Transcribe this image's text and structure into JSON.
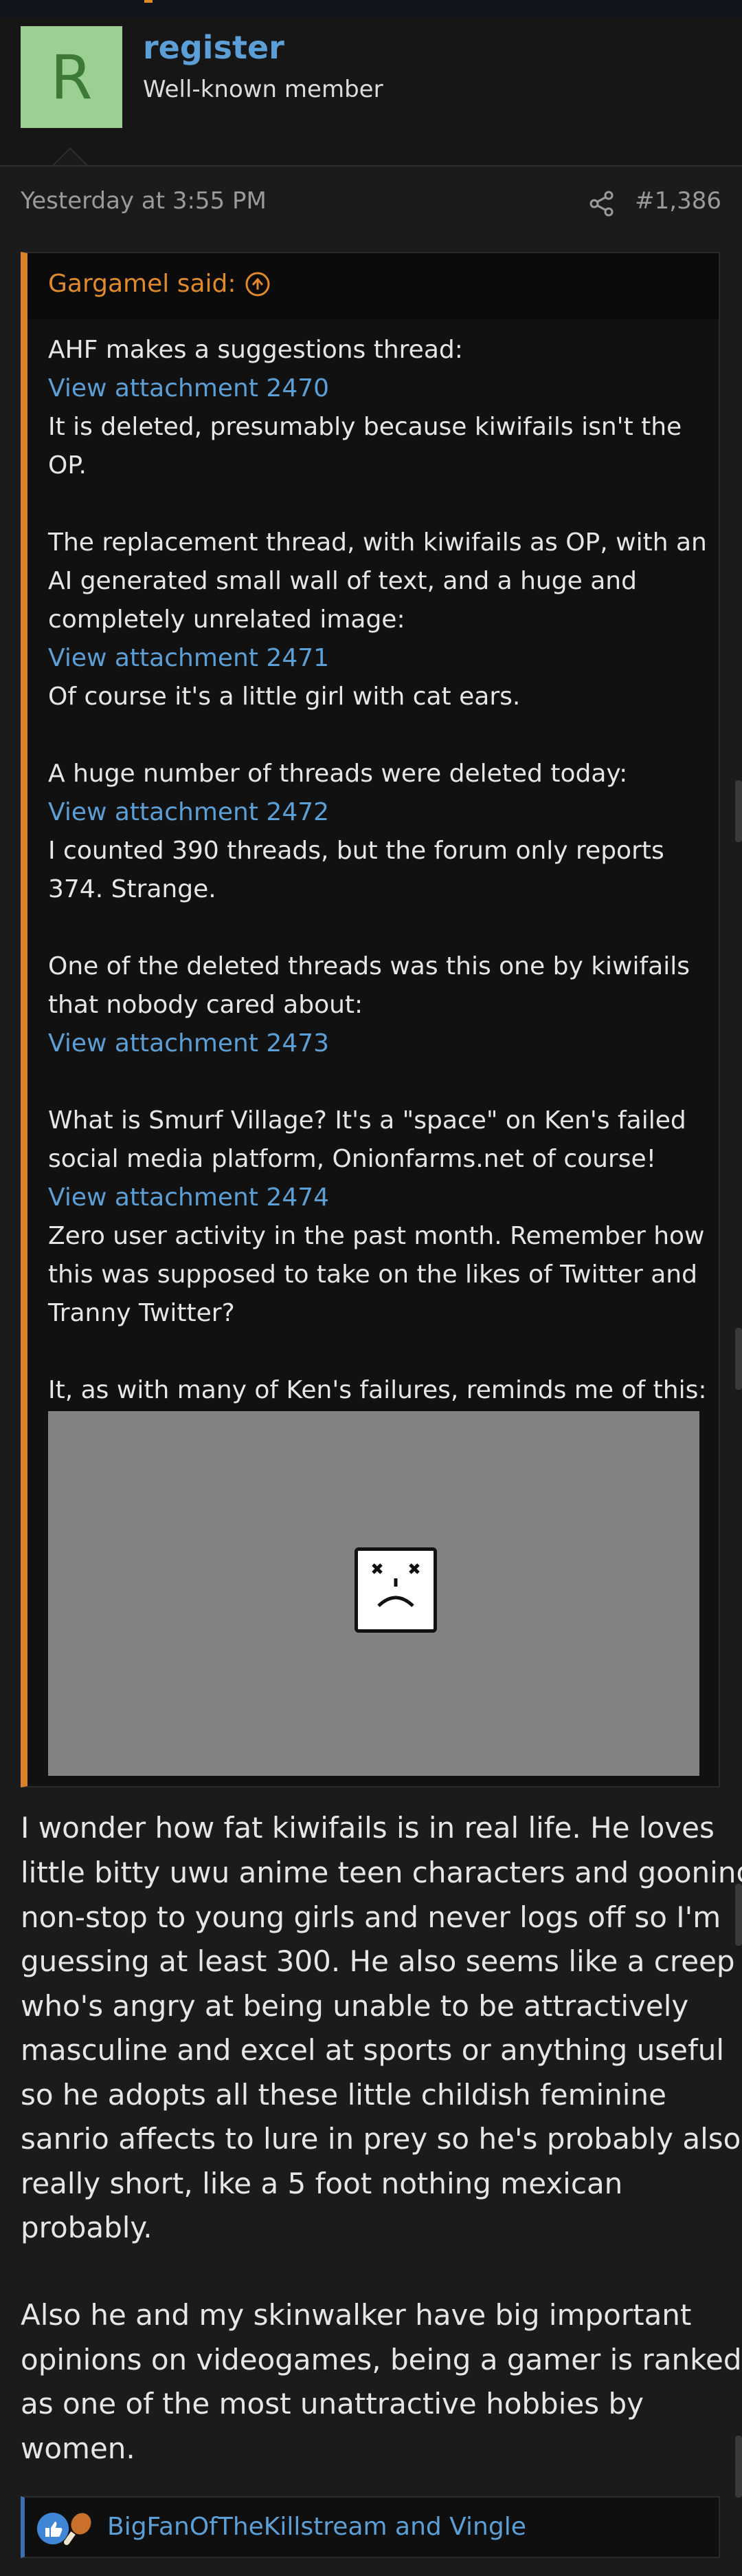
{
  "user": {
    "avatar_letter": "R",
    "name": "register",
    "title": "Well-known member"
  },
  "post": {
    "time": "Yesterday at 3:55 PM",
    "number": "#1,386"
  },
  "quote": {
    "author": "Gargamel said:",
    "lines": [
      {
        "text": "AHF makes a suggestions thread:",
        "link": false
      },
      {
        "text": "View attachment 2470",
        "link": true
      },
      {
        "text": "It is deleted, presumably because kiwifails isn't the",
        "link": false
      },
      {
        "text": "OP.",
        "link": false
      },
      {
        "text": "The replacement thread, with kiwifails as OP, with an",
        "link": false
      },
      {
        "text": "AI generated small wall of text, and a huge and",
        "link": false
      },
      {
        "text": "completely unrelated image:",
        "link": false
      },
      {
        "text": "View attachment 2471",
        "link": true
      },
      {
        "text": "Of course it's a little girl with cat ears.",
        "link": false
      },
      {
        "text": "A huge number of threads were deleted today:",
        "link": false
      },
      {
        "text": "View attachment 2472",
        "link": true
      },
      {
        "text": "I counted 390 threads, but the forum only reports",
        "link": false
      },
      {
        "text": "374. Strange.",
        "link": false
      },
      {
        "text": "One of the deleted threads was this one by kiwifails",
        "link": false
      },
      {
        "text": "that nobody cared about:",
        "link": false
      },
      {
        "text": "View attachment 2473",
        "link": true
      },
      {
        "text": "What is Smurf Village? It's a \"space\" on Ken's failed",
        "link": false
      },
      {
        "text": "social media platform, Onionfarms.net of course!",
        "link": false
      },
      {
        "text": "View attachment 2474",
        "link": true
      },
      {
        "text": "Zero user activity in the past month. Remember how",
        "link": false
      },
      {
        "text": "this was supposed to take on the likes of Twitter and",
        "link": false
      },
      {
        "text": "Tranny Twitter?",
        "link": false
      },
      {
        "text": "It, as with many of Ken's failures, reminds me of this:",
        "link": false
      }
    ]
  },
  "body": {
    "lines": [
      "I wonder how fat kiwifails is in real life. He loves",
      "little bitty uwu anime teen characters and gooning",
      "non-stop to young girls and never logs off so I'm",
      "guessing at least 300. He also seems like a creep",
      "who's angry at being unable to be attractively",
      "masculine and excel at sports or anything useful",
      "so he adopts all these little childish feminine",
      "sanrio affects to lure in prey so he's probably also",
      "really short, like a 5 foot nothing mexican",
      "probably.",
      "Also he and my skinwalker have big important",
      "opinions on videogames, being a gamer is ranked",
      "as one of the most unattractive hobbies by",
      "women."
    ]
  },
  "reactions": {
    "names": "BigFanOfTheKillstream and Vingle"
  },
  "colors": {
    "link": "#5b9fd6",
    "quote_accent": "#d9822b",
    "background": "#1b1b1b"
  }
}
